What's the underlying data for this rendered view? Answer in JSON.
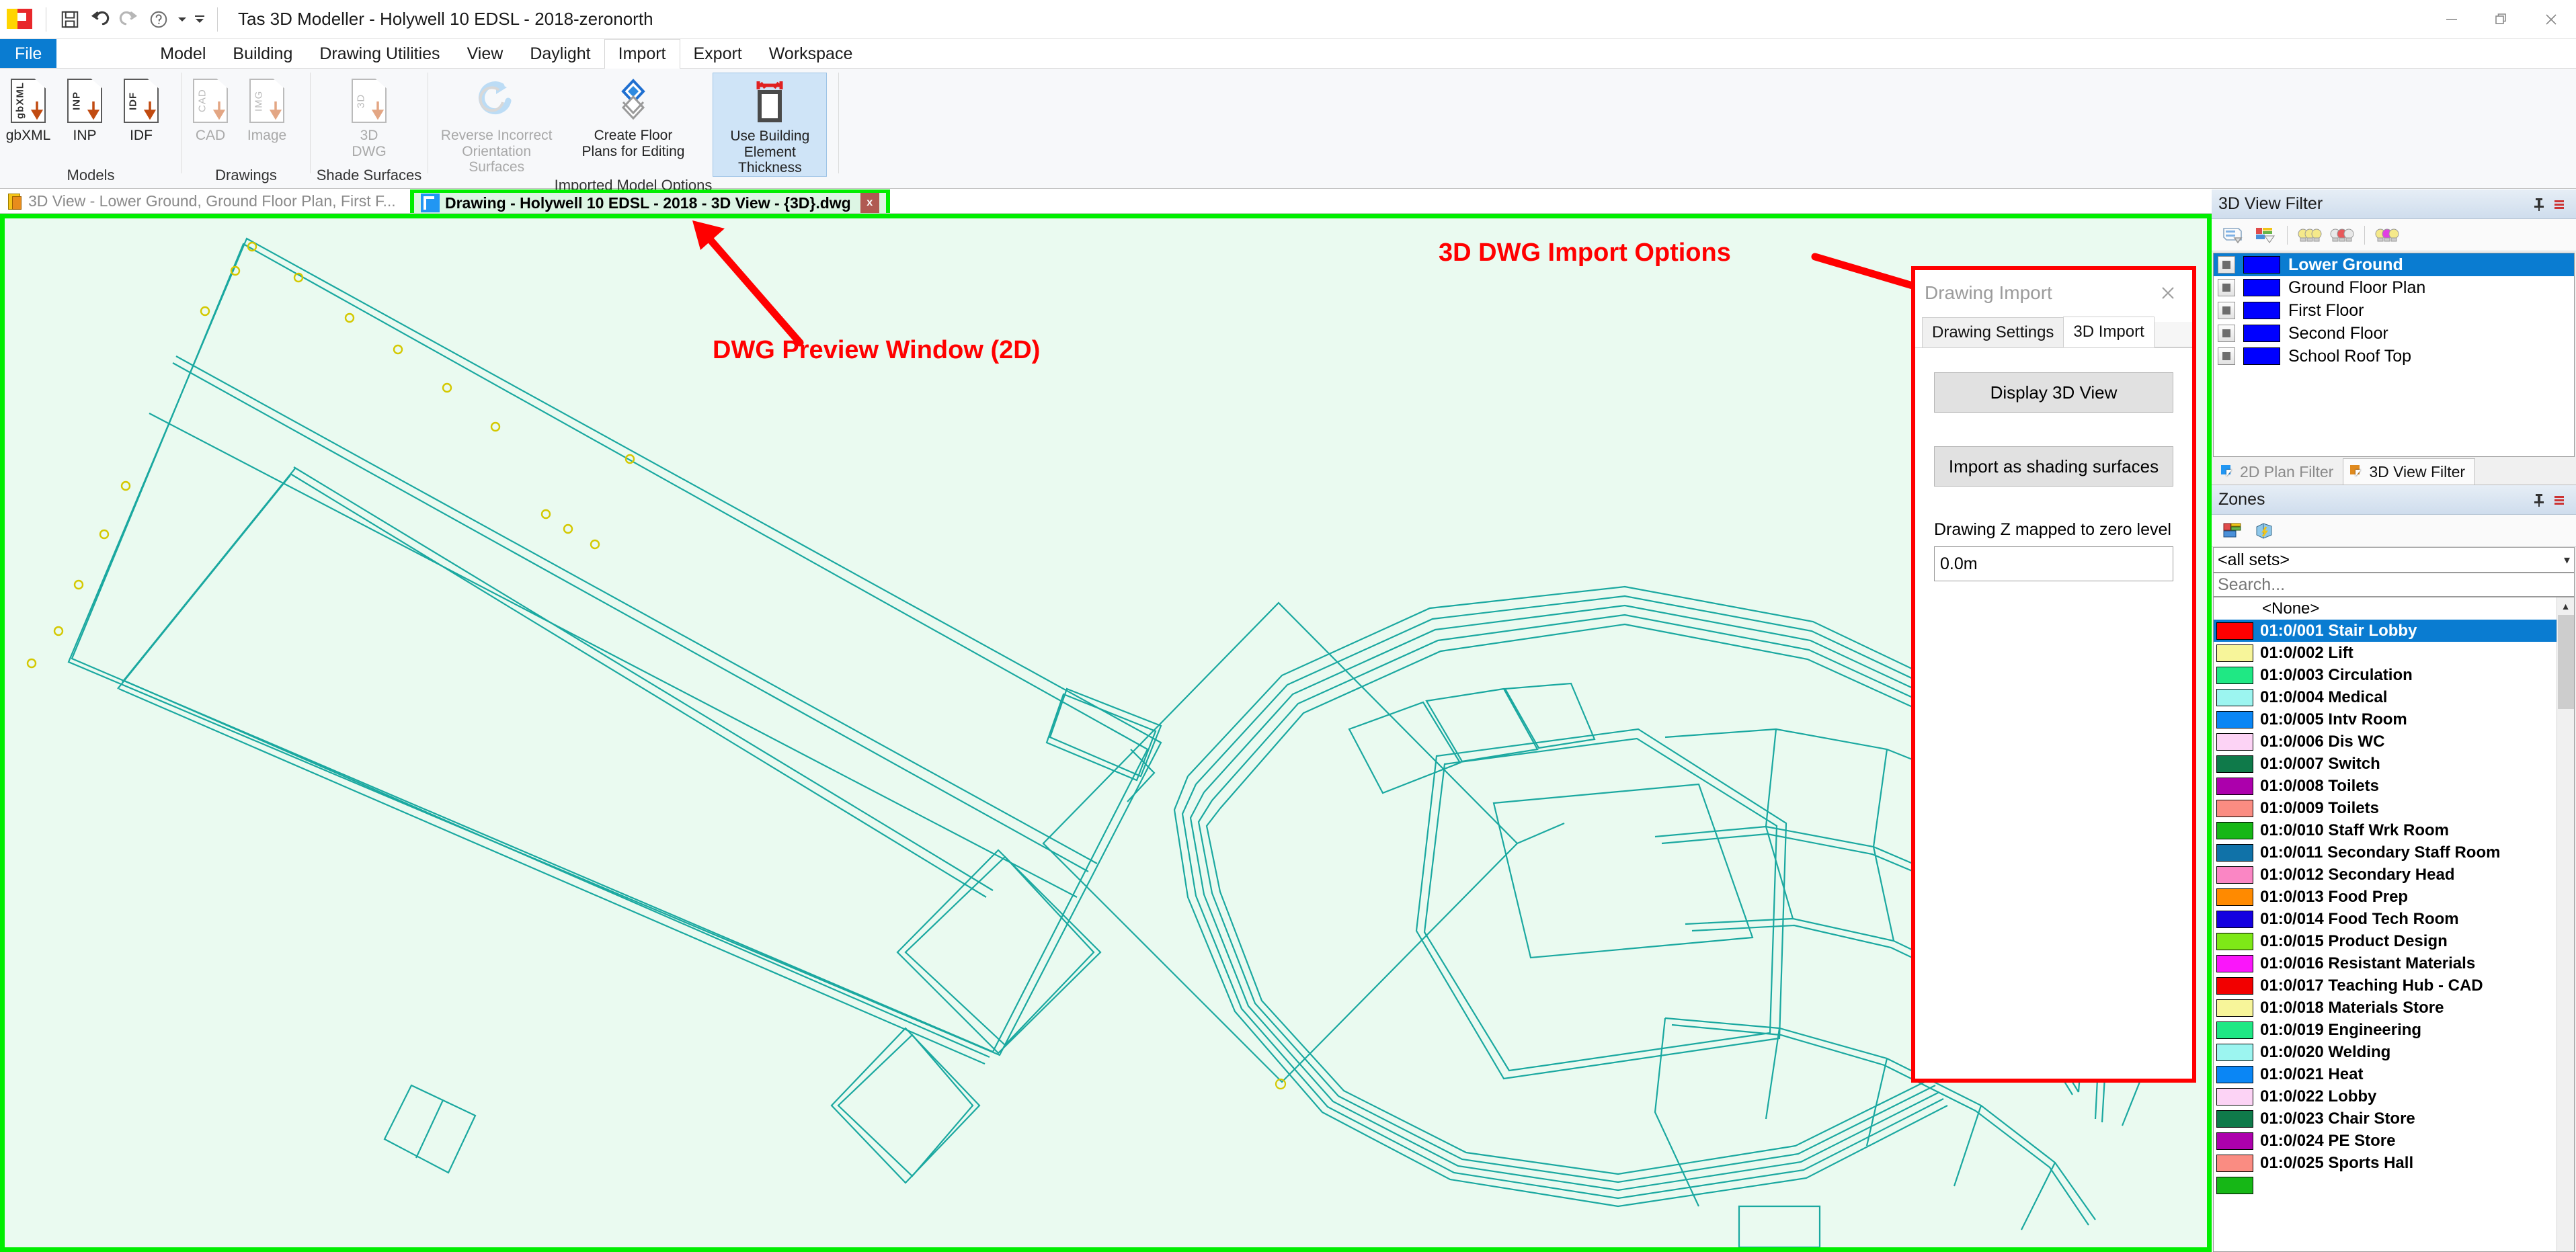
{
  "window": {
    "title": "Tas 3D Modeller - Holywell 10 EDSL - 2018-zeronorth",
    "minimize_label": "Minimize",
    "restore_label": "Restore",
    "close_label": "Close",
    "quick_access": [
      {
        "name": "save-icon",
        "label": "Save"
      },
      {
        "name": "undo-icon",
        "label": "Undo"
      },
      {
        "name": "redo-icon",
        "label": "Redo"
      },
      {
        "name": "help-icon",
        "label": "Help"
      },
      {
        "name": "customize-qat-icon",
        "label": "Customize Quick Access Toolbar"
      }
    ]
  },
  "menubar": {
    "file_label": "File",
    "items": [
      {
        "label": "Model",
        "active": false
      },
      {
        "label": "Building",
        "active": false
      },
      {
        "label": "Drawing Utilities",
        "active": false
      },
      {
        "label": "View",
        "active": false
      },
      {
        "label": "Daylight",
        "active": false
      },
      {
        "label": "Import",
        "active": true
      },
      {
        "label": "Export",
        "active": false
      },
      {
        "label": "Workspace",
        "active": false
      }
    ]
  },
  "ribbon": {
    "groups": [
      {
        "label": "Models",
        "buttons": [
          {
            "label1": "gbXML",
            "label2": "",
            "icon_text": "gbXML",
            "state": "enabled"
          },
          {
            "label1": "INP",
            "label2": "",
            "icon_text": "INP",
            "state": "enabled"
          },
          {
            "label1": "IDF",
            "label2": "",
            "icon_text": "IDF",
            "state": "enabled"
          }
        ]
      },
      {
        "label": "Drawings",
        "buttons": [
          {
            "label1": "CAD",
            "label2": "",
            "icon_text": "CAD",
            "state": "disabled"
          },
          {
            "label1": "Image",
            "label2": "",
            "icon_text": "IMG",
            "state": "disabled"
          }
        ]
      },
      {
        "label": "Shade Surfaces",
        "buttons": [
          {
            "label1": "3D",
            "label2": "DWG",
            "icon_text": "3D",
            "state": "disabled"
          }
        ]
      },
      {
        "label": "Imported Model Options",
        "buttons": [
          {
            "label1": "Reverse Incorrect",
            "label2": "Orientation Surfaces",
            "icon_text": "",
            "state": "disabled"
          },
          {
            "label1": "Create Floor",
            "label2": "Plans for Editing",
            "icon_text": "",
            "state": "enabled"
          },
          {
            "label1": "Use Building",
            "label2": "Element Thickness",
            "icon_text": "",
            "state": "selected"
          }
        ]
      }
    ]
  },
  "document_tabs": [
    {
      "label": "3D View - Lower Ground, Ground Floor Plan, First F...",
      "active": false,
      "icon": "model-3d-icon",
      "closable": false
    },
    {
      "label": "Drawing - Holywell 10 EDSL - 2018 - 3D View - {3D}.dwg",
      "active": true,
      "icon": "dwg-drawing-icon",
      "closable": true,
      "close_label": "x"
    }
  ],
  "annotations": [
    {
      "text": "DWG Preview Window (2D)",
      "color": "#ff0000"
    },
    {
      "text": "3D DWG Import Options",
      "color": "#ff0000"
    }
  ],
  "canvas": {
    "background_color": "#eafaf0",
    "line_color": "#1aa8a0",
    "highlight_border_color": "#00ee00",
    "marker_color": "#d4c800"
  },
  "dialog": {
    "title": "Drawing Import",
    "close_label": "✕",
    "highlight_color": "#ff0000",
    "tabs": [
      {
        "label": "Drawing Settings",
        "active": false
      },
      {
        "label": "3D Import",
        "active": true
      }
    ],
    "buttons": [
      {
        "label": "Display 3D View"
      },
      {
        "label": "Import as shading surfaces"
      }
    ],
    "field_label": "Drawing Z mapped to zero level",
    "field_value": "0.0m"
  },
  "view_filter_panel": {
    "title": "3D View Filter",
    "pin_label": "Auto Hide",
    "menu_label": "Panel Menu",
    "toolbar": [
      {
        "name": "edit-filter-icon",
        "label": "Edit Filter"
      },
      {
        "name": "apply-filter-icon",
        "label": "Apply Filter"
      },
      {
        "name": "lights-all-icon",
        "label": "Show All"
      },
      {
        "name": "lights-selected-icon",
        "label": "Show Selected"
      },
      {
        "name": "lights-highlight-icon",
        "label": "Highlight"
      }
    ],
    "items": [
      {
        "label": "Lower Ground",
        "color": "#0000ff",
        "selected": true,
        "checked": true
      },
      {
        "label": "Ground Floor Plan",
        "color": "#0000ff",
        "selected": false,
        "checked": true
      },
      {
        "label": "First Floor",
        "color": "#0000ff",
        "selected": false,
        "checked": true
      },
      {
        "label": "Second Floor",
        "color": "#0000ff",
        "selected": false,
        "checked": true
      },
      {
        "label": "School Roof Top",
        "color": "#0000ff",
        "selected": false,
        "checked": true
      }
    ],
    "tabs": [
      {
        "label": "2D Plan Filter",
        "active": false,
        "color": "#2196f3"
      },
      {
        "label": "3D View Filter",
        "active": true,
        "color": "#e08a1e"
      }
    ]
  },
  "zones_panel": {
    "title": "Zones",
    "pin_label": "Auto Hide",
    "menu_label": "Panel Menu",
    "toolbar": [
      {
        "name": "zone-groups-icon",
        "label": "Zone Groups"
      },
      {
        "name": "zone-highlight-icon",
        "label": "Highlight Zone"
      }
    ],
    "set_selector_value": "<all sets>",
    "search_placeholder": "Search...",
    "none_label": "<None>",
    "zones": [
      {
        "label": "01:0/001 Stair Lobby",
        "color": "#ff0000",
        "selected": true
      },
      {
        "label": "01:0/002 Lift",
        "color": "#f7f59a",
        "selected": false
      },
      {
        "label": "01:0/003 Circulation",
        "color": "#1fe884",
        "selected": false
      },
      {
        "label": "01:0/004 Medical",
        "color": "#9cf5f0",
        "selected": false
      },
      {
        "label": "01:0/005 Intv Room",
        "color": "#0a86f5",
        "selected": false
      },
      {
        "label": "01:0/006 Dis WC",
        "color": "#fcd3f5",
        "selected": false
      },
      {
        "label": "01:0/007 Switch",
        "color": "#0f7a4a",
        "selected": false
      },
      {
        "label": "01:0/008 Toilets",
        "color": "#ac00ac",
        "selected": false
      },
      {
        "label": "01:0/009 Toilets",
        "color": "#fa8c82",
        "selected": false
      },
      {
        "label": "01:0/010 Staff Wrk Room",
        "color": "#16b716",
        "selected": false
      },
      {
        "label": "01:0/011 Secondary Staff Room",
        "color": "#1072a8",
        "selected": false
      },
      {
        "label": "01:0/012 Secondary Head",
        "color": "#fa86c4",
        "selected": false
      },
      {
        "label": "01:0/013 Food Prep",
        "color": "#ff8a00",
        "selected": false
      },
      {
        "label": "01:0/014 Food Tech Room",
        "color": "#1400e0",
        "selected": false
      },
      {
        "label": "01:0/015 Product Design",
        "color": "#7ee817",
        "selected": false
      },
      {
        "label": "01:0/016 Resistant Materials",
        "color": "#fa16fa",
        "selected": false
      },
      {
        "label": "01:0/017 Teaching Hub - CAD",
        "color": "#f20000",
        "selected": false
      },
      {
        "label": "01:0/018 Materials Store",
        "color": "#f7f59a",
        "selected": false
      },
      {
        "label": "01:0/019 Engineering",
        "color": "#1fe884",
        "selected": false
      },
      {
        "label": "01:0/020 Welding",
        "color": "#9cf5f0",
        "selected": false
      },
      {
        "label": "01:0/021 Heat",
        "color": "#0a86f5",
        "selected": false
      },
      {
        "label": "01:0/022 Lobby",
        "color": "#fcd3f5",
        "selected": false
      },
      {
        "label": "01:0/023 Chair Store",
        "color": "#0f7a4a",
        "selected": false
      },
      {
        "label": "01:0/024 PE Store",
        "color": "#ac00ac",
        "selected": false
      },
      {
        "label": "01:0/025 Sports Hall",
        "color": "#fa8c82",
        "selected": false
      },
      {
        "label": "",
        "color": "#16b716",
        "selected": false
      }
    ]
  }
}
